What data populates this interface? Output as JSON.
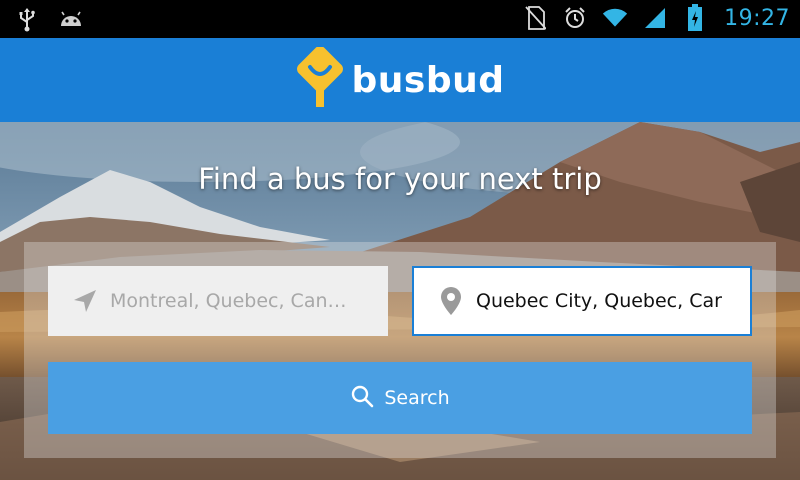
{
  "status_bar": {
    "left_icons": [
      "usb-icon",
      "android-icon"
    ],
    "right_icons": [
      "no-sim-icon",
      "alarm-icon",
      "wifi-icon",
      "signal-icon",
      "battery-icon"
    ],
    "time": "19:27",
    "accent_color": "#33b5e5"
  },
  "app_bar": {
    "brand": "busbud",
    "background_color": "#1a7fd6",
    "logo_icon": "busbud-logo-icon",
    "logo_color": "#f7c12e"
  },
  "hero": {
    "headline": "Find a bus for your next trip"
  },
  "search": {
    "origin_placeholder": "Montreal, Quebec, Can…",
    "origin_icon": "navigation-arrow-icon",
    "destination_value": "Quebec City, Quebec, Car",
    "destination_icon": "location-pin-icon",
    "button_label": "Search",
    "button_icon": "search-icon",
    "button_color": "#4a9fe3"
  }
}
